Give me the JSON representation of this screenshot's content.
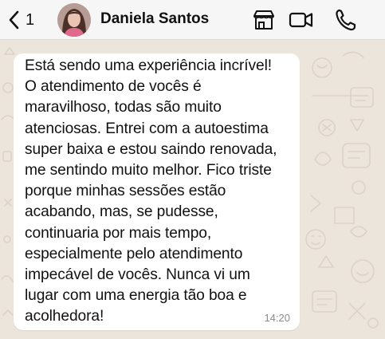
{
  "header": {
    "back_count": "1",
    "contact_name": "Daniela Santos",
    "icons": [
      "chevron-left-icon",
      "store-icon",
      "video-camera-icon",
      "phone-icon"
    ],
    "accent_color": "#111111"
  },
  "chat": {
    "background_color": "#ece5dc",
    "messages": [
      {
        "direction": "incoming",
        "text": "Está sendo uma experiência incrível!\nO atendimento de vocês é\nmaravilhoso, todas são muito\natenciosas. Entrei com a autoestima\nsuper baixa e estou saindo renovada,\nme sentindo muito melhor. Fico triste\nporque minhas sessões estão\nacabando, mas, se pudesse,\ncontinuaria por mais tempo,\nespecialmente pelo atendimento\nimpecável de vocês. Nunca vi um\nlugar com uma energia tão boa e\nacolhedora!",
        "time": "14:20"
      }
    ]
  }
}
